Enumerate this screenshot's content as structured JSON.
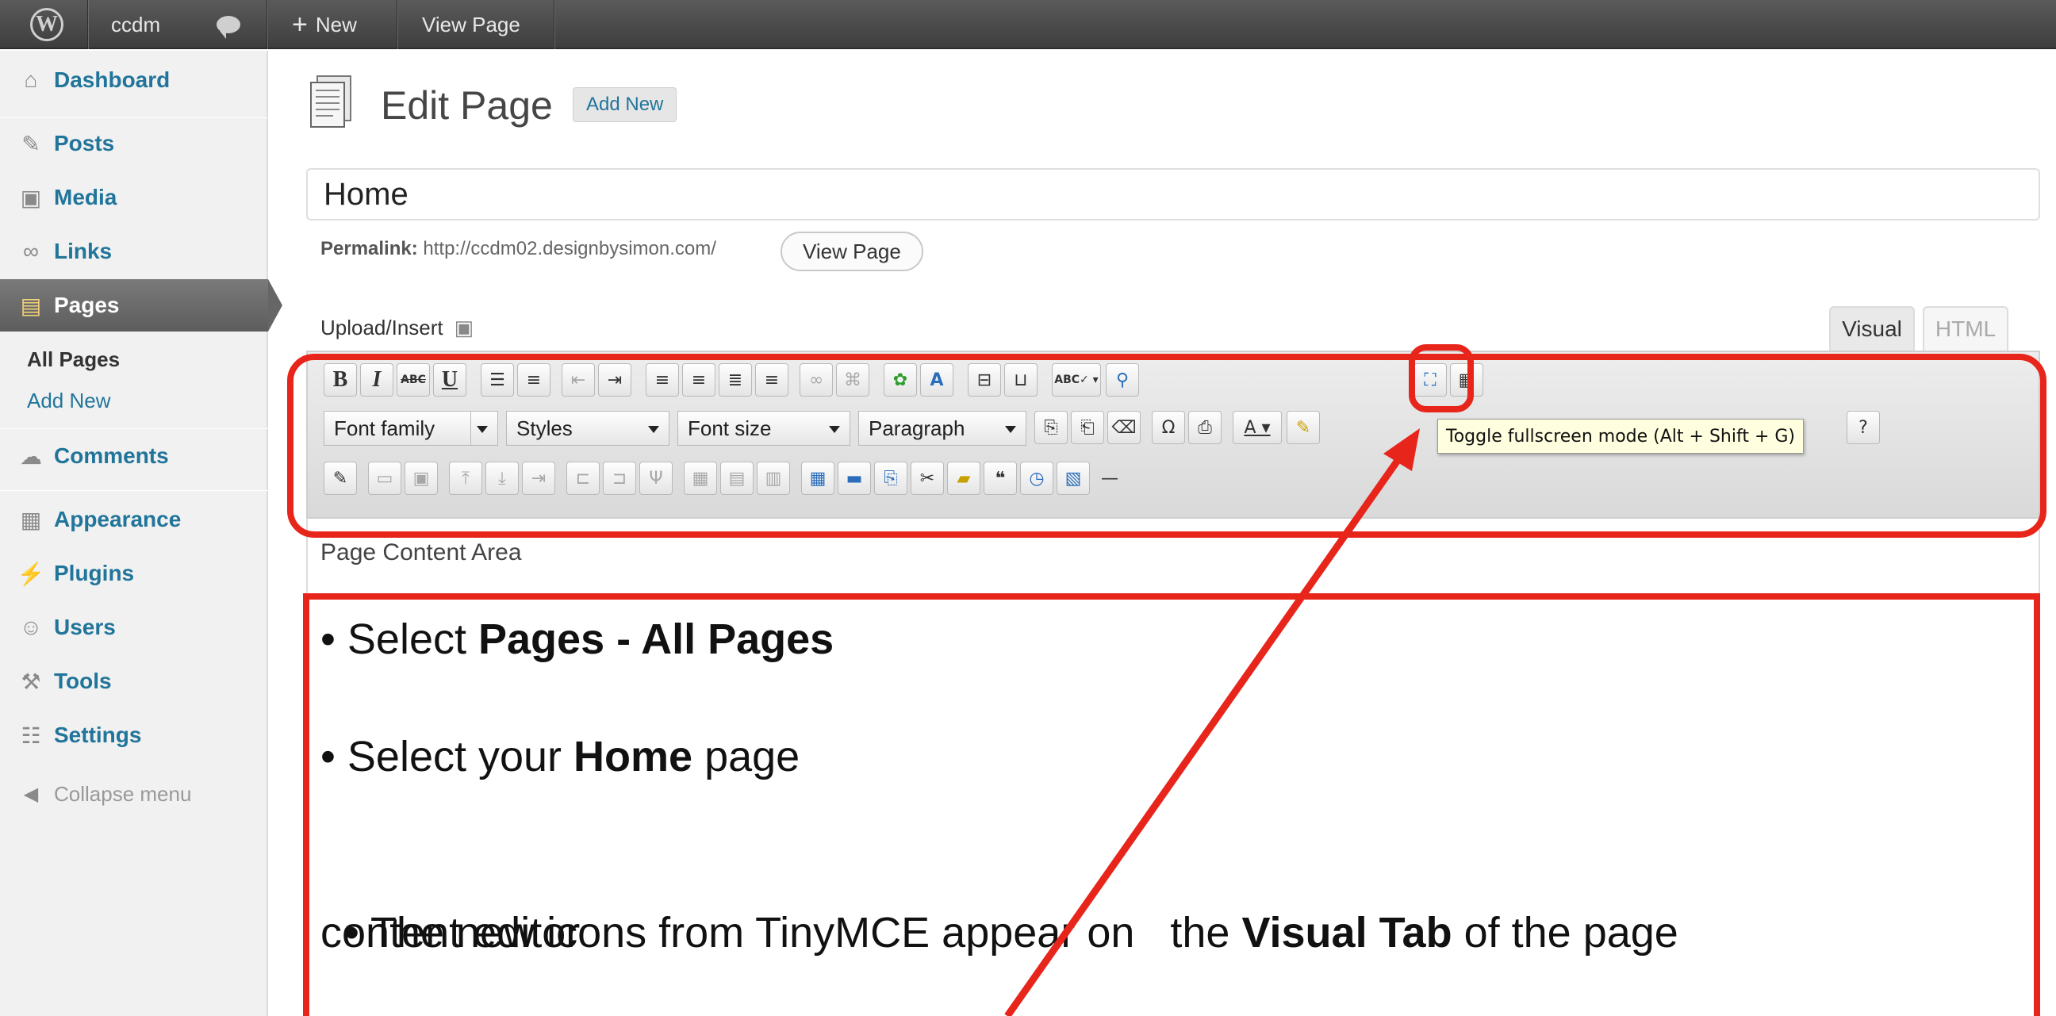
{
  "adminbar": {
    "site_name": "ccdm",
    "new_label": "New",
    "view_page_label": "View Page"
  },
  "sidebar": {
    "items": [
      {
        "label": "Dashboard",
        "icon": "house-icon"
      },
      {
        "label": "Posts",
        "icon": "pushpin-icon"
      },
      {
        "label": "Media",
        "icon": "media-icon"
      },
      {
        "label": "Links",
        "icon": "link-icon"
      },
      {
        "label": "Pages",
        "icon": "pages-icon"
      },
      {
        "label": "Comments",
        "icon": "comment-icon"
      },
      {
        "label": "Appearance",
        "icon": "appearance-icon"
      },
      {
        "label": "Plugins",
        "icon": "plug-icon"
      },
      {
        "label": "Users",
        "icon": "users-icon"
      },
      {
        "label": "Tools",
        "icon": "tools-icon"
      },
      {
        "label": "Settings",
        "icon": "settings-icon"
      }
    ],
    "submenu": [
      "All Pages",
      "Add New"
    ],
    "collapse_label": "Collapse menu"
  },
  "main": {
    "title": "Edit Page",
    "add_new": "Add New",
    "post_title": "Home",
    "permalink_label": "Permalink:",
    "permalink_url": "http://ccdm02.designbysimon.com/",
    "view_page_btn": "View Page",
    "upload_insert": "Upload/Insert",
    "tabs": {
      "visual": "Visual",
      "html": "HTML"
    }
  },
  "toolbar": {
    "font_family": "Font family",
    "styles": "Styles",
    "font_size": "Font size",
    "format": "Paragraph",
    "tooltip": "Toggle fullscreen mode (Alt + Shift + G)"
  },
  "content": {
    "label": "Page Content Area"
  },
  "instructions": [
    {
      "pre": "• Select ",
      "bold": "Pages - All Pages",
      "post": ""
    },
    {
      "pre": "• Select your ",
      "bold": "Home",
      "post": " page"
    },
    {
      "pre": "• The new icons from TinyMCE appear on   the ",
      "bold": "Visual Tab",
      "post": " of the page"
    },
    {
      "pre": "content editor",
      "bold": "",
      "post": ""
    }
  ],
  "colors": {
    "annotation_red": "#e8251b",
    "link_blue": "#21759b",
    "tooltip_bg": "#ffffe0"
  }
}
